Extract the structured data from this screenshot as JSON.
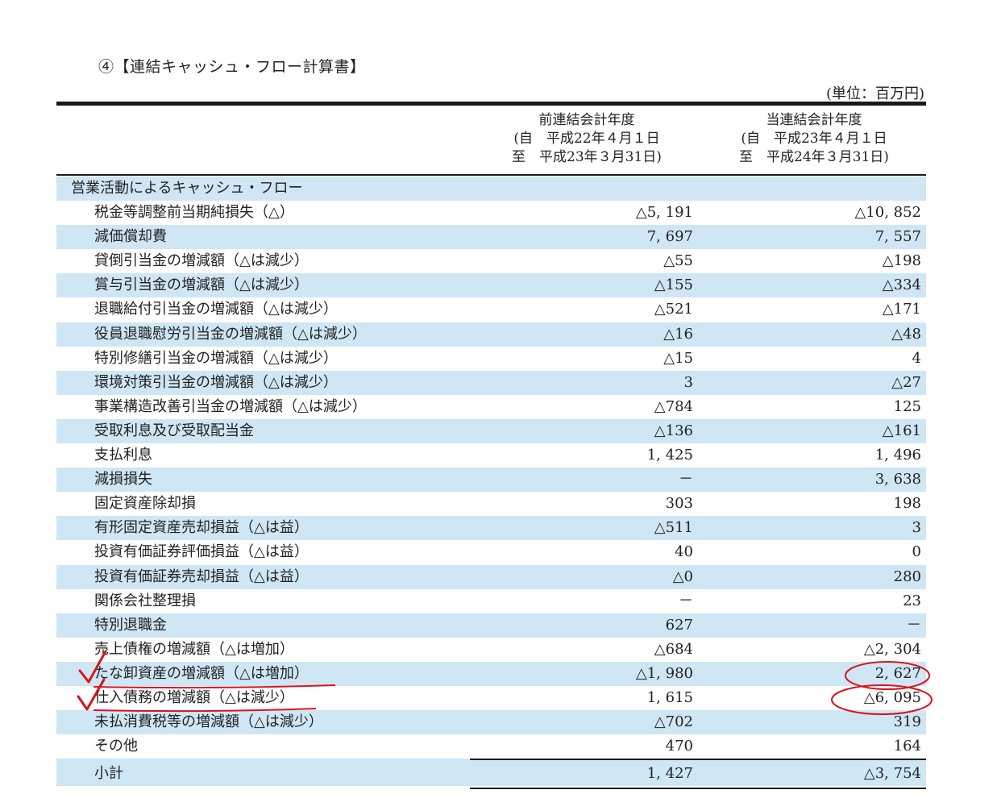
{
  "title": "④【連結キャッシュ・フロー計算書】",
  "unit": "(単位：百万円)",
  "columns": {
    "prev": {
      "line1": "前連結会計年度",
      "line2": "(自　平成22年４月１日",
      "line3": "至　平成23年３月31日)"
    },
    "cur": {
      "line1": "当連結会計年度",
      "line2": "(自　平成23年４月１日",
      "line3": "至　平成24年３月31日)"
    }
  },
  "rows": [
    {
      "label": "営業活動によるキャッシュ・フロー",
      "v1": "",
      "v2": ""
    },
    {
      "label": "税金等調整前当期純損失（△）",
      "v1": "△5, 191",
      "v2": "△10, 852"
    },
    {
      "label": "減価償却費",
      "v1": "7, 697",
      "v2": "7, 557"
    },
    {
      "label": "貸倒引当金の増減額（△は減少）",
      "v1": "△55",
      "v2": "△198"
    },
    {
      "label": "賞与引当金の増減額（△は減少）",
      "v1": "△155",
      "v2": "△334"
    },
    {
      "label": "退職給付引当金の増減額（△は減少）",
      "v1": "△521",
      "v2": "△171"
    },
    {
      "label": "役員退職慰労引当金の増減額（△は減少）",
      "v1": "△16",
      "v2": "△48"
    },
    {
      "label": "特別修繕引当金の増減額（△は減少）",
      "v1": "△15",
      "v2": "4"
    },
    {
      "label": "環境対策引当金の増減額（△は減少）",
      "v1": "3",
      "v2": "△27"
    },
    {
      "label": "事業構造改善引当金の増減額（△は減少）",
      "v1": "△784",
      "v2": "125"
    },
    {
      "label": "受取利息及び受取配当金",
      "v1": "△136",
      "v2": "△161"
    },
    {
      "label": "支払利息",
      "v1": "1, 425",
      "v2": "1, 496"
    },
    {
      "label": "減損損失",
      "v1": "－",
      "v2": "3, 638"
    },
    {
      "label": "固定資産除却損",
      "v1": "303",
      "v2": "198"
    },
    {
      "label": "有形固定資産売却損益（△は益）",
      "v1": "△511",
      "v2": "3"
    },
    {
      "label": "投資有価証券評価損益（△は益）",
      "v1": "40",
      "v2": "0"
    },
    {
      "label": "投資有価証券売却損益（△は益）",
      "v1": "△0",
      "v2": "280"
    },
    {
      "label": "関係会社整理損",
      "v1": "－",
      "v2": "23"
    },
    {
      "label": "特別退職金",
      "v1": "627",
      "v2": "－"
    },
    {
      "label": "売上債権の増減額（△は増加）",
      "v1": "△684",
      "v2": "△2, 304"
    },
    {
      "label": "たな卸資産の増減額（△は増加）",
      "v1": "△1, 980",
      "v2": "2, 627"
    },
    {
      "label": "仕入債務の増減額（△は減少）",
      "v1": "1, 615",
      "v2": "△6, 095"
    },
    {
      "label": "未払消費税等の増減額（△は減少）",
      "v1": "△702",
      "v2": "319"
    },
    {
      "label": "その他",
      "v1": "470",
      "v2": "164"
    },
    {
      "label": "小計",
      "v1": "1, 427",
      "v2": "△3, 754"
    }
  ],
  "annotation_color": "#d9141e",
  "row_shade_color": "#cfe6f5"
}
